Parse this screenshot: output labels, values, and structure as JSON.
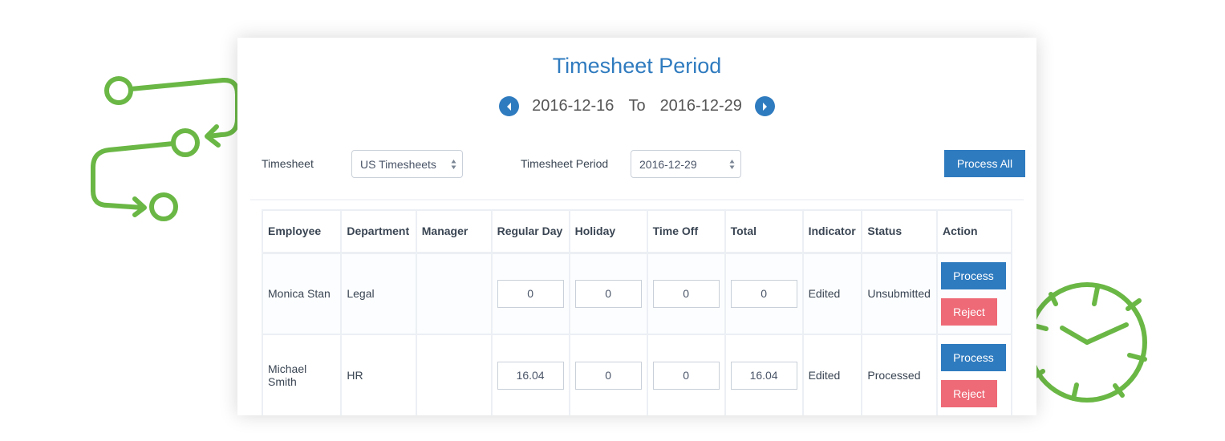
{
  "header": {
    "title": "Timesheet Period",
    "period_start": "2016-12-16",
    "period_separator": "To",
    "period_end": "2016-12-29"
  },
  "filters": {
    "timesheet_label": "Timesheet",
    "timesheet_value": "US Timesheets",
    "period_label": "Timesheet Period",
    "period_value": "2016-12-29",
    "process_all_label": "Process All"
  },
  "table": {
    "columns": [
      "Employee",
      "Department",
      "Manager",
      "Regular Day",
      "Holiday",
      "Time Off",
      "Total",
      "Indicator",
      "Status",
      "Action"
    ],
    "rows": [
      {
        "employee": "Monica Stan",
        "department": "Legal",
        "manager": "",
        "regular_day": "0",
        "holiday": "0",
        "time_off": "0",
        "total": "0",
        "indicator": "Edited",
        "status": "Unsubmitted",
        "process_label": "Process",
        "reject_label": "Reject"
      },
      {
        "employee": "Michael Smith",
        "department": "HR",
        "manager": "",
        "regular_day": "16.04",
        "holiday": "0",
        "time_off": "0",
        "total": "16.04",
        "indicator": "Edited",
        "status": "Processed",
        "process_label": "Process",
        "reject_label": "Reject"
      }
    ]
  },
  "colors": {
    "accent": "#2f7bbf",
    "danger": "#ee6a77",
    "decor_green": "#6ab745"
  },
  "icons": {
    "prev": "chevron-left-circle-icon",
    "next": "chevron-right-circle-icon",
    "select_arrows": "sort-arrows-icon",
    "decor_left": "workflow-arrows-icon",
    "decor_right": "clock-icon"
  }
}
